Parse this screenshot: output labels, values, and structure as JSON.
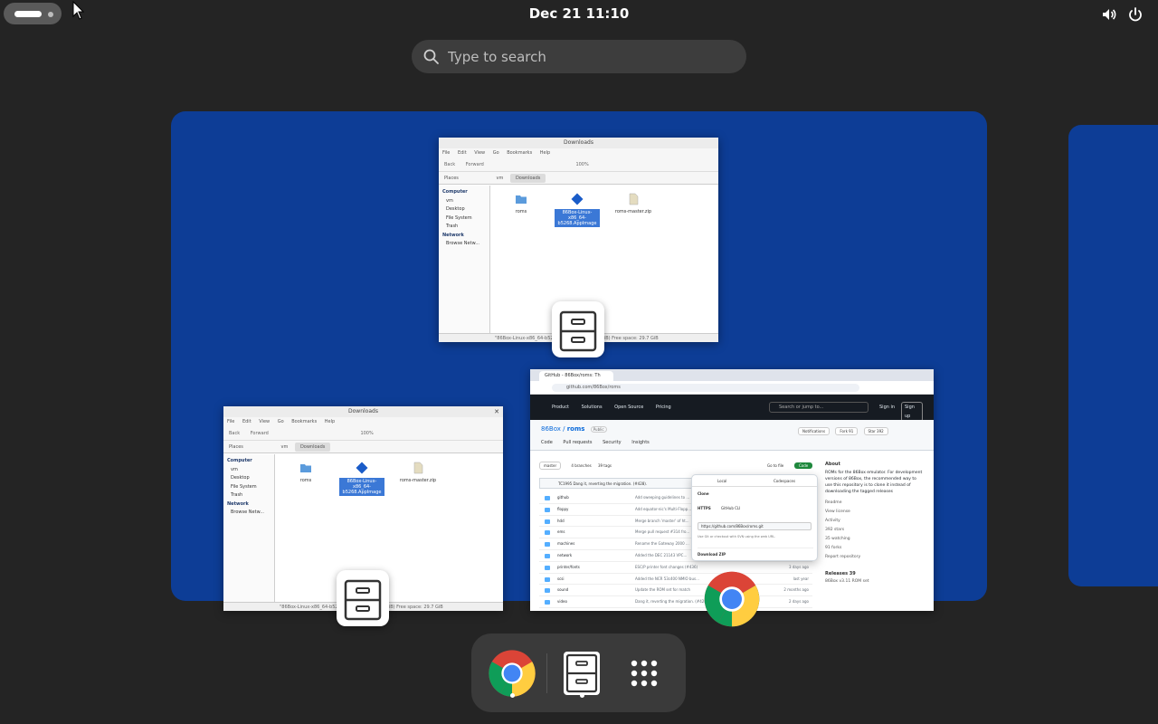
{
  "topbar": {
    "clock": "Dec 21  11:10",
    "icons": [
      "volume-icon",
      "power-icon"
    ]
  },
  "search": {
    "placeholder": "Type to search"
  },
  "fm_small": {
    "title": "Downloads",
    "menu": [
      "File",
      "Edit",
      "View",
      "Go",
      "Bookmarks",
      "Help"
    ],
    "tools": [
      "Back",
      "Forward",
      "100%"
    ],
    "path_root": "vm",
    "path_current": "Downloads",
    "places_label": "Places",
    "sidebar": {
      "computer": "Computer",
      "items": [
        "vm",
        "Desktop",
        "File System",
        "Trash"
      ],
      "network": "Network",
      "browse": "Browse Netw..."
    },
    "files": [
      {
        "name": "roms",
        "type": "folder"
      },
      {
        "name": "86Box-Linux-x86_64-b5268.AppImage",
        "type": "appimage"
      },
      {
        "name": "roms-master.zip",
        "type": "zip"
      }
    ],
    "status": "\"86Box-Linux-x86_64-b5268.AppImage\" (55.4 MiB) Free space: 29.7 GiB"
  },
  "fm_large": {
    "title": "Downloads",
    "menu": [
      "File",
      "Edit",
      "View",
      "Go",
      "Bookmarks",
      "Help"
    ],
    "tools": [
      "Back",
      "Forward",
      "100%"
    ],
    "path_root": "vm",
    "path_current": "Downloads",
    "places_label": "Places",
    "sidebar": {
      "computer": "Computer",
      "items": [
        "vm",
        "Desktop",
        "File System",
        "Trash"
      ],
      "network": "Network",
      "browse": "Browse Netw..."
    },
    "files": [
      {
        "name": "roms",
        "type": "folder"
      },
      {
        "name": "86Box-Linux-x86_64-b5268.AppImage",
        "type": "appimage"
      },
      {
        "name": "roms-master.zip",
        "type": "zip"
      }
    ],
    "status": "\"86Box-Linux-x86_64-b5268.AppImage\" (55.4 MiB) Free space: 29.7 GiB"
  },
  "chrome": {
    "tab": "GitHub - 86Box/roms: Th",
    "url": "github.com/86Box/roms",
    "gh_nav": [
      "Product",
      "Solutions",
      "Open Source",
      "Pricing"
    ],
    "gh_search": "Search or jump to...",
    "signin": "Sign in",
    "signup": "Sign up",
    "repo_owner": "86Box",
    "repo_name": "roms",
    "repo_visibility": "Public",
    "repo_tabs": [
      "Code",
      "Pull requests",
      "Security",
      "Insights"
    ],
    "repo_actions": [
      "Notifications",
      "Fork 91",
      "Star 392"
    ],
    "branch": "master",
    "branches": "4 branches",
    "tags": "39 tags",
    "go_to_file": "Go to file",
    "code_btn": "Code",
    "commit": "TC1995 Dang it, reverting the migration. (#428).",
    "rows": [
      {
        "name": "github",
        "msg": "Add sweeping guidelines to ...",
        "date": ""
      },
      {
        "name": "floppy",
        "msg": "Add equator-nic's Multi-Flopp...",
        "date": ""
      },
      {
        "name": "hdd",
        "msg": "Merge branch 'master' of ht...",
        "date": ""
      },
      {
        "name": "ems",
        "msg": "Merge pull request #314 fro...",
        "date": ""
      },
      {
        "name": "machines",
        "msg": "Rename the Gateway 2000 ...",
        "date": ""
      },
      {
        "name": "network",
        "msg": "Added the DEC 21143 VPC...",
        "date": ""
      },
      {
        "name": "printer/fonts",
        "msg": "ESC/P printer font changes (#436)",
        "date": "3 days ago"
      },
      {
        "name": "scsi",
        "msg": "Added the NCR 53c400 NMIO bus...",
        "date": "last year"
      },
      {
        "name": "sound",
        "msg": "Update the ROM set for match",
        "date": "2 months ago"
      },
      {
        "name": "video",
        "msg": "Dang it, reverting the migration. (#428)",
        "date": "2 days ago"
      }
    ],
    "about_title": "About",
    "about_text": "ROMs for the 86Box emulator. For development versions of 86Box, the recommended way to use this repository is to clone it instead of downloading the tagged releases",
    "about_links": [
      "Readme",
      "View license",
      "Activity",
      "392 stars",
      "35 watching",
      "91 forks",
      "Report repository"
    ],
    "releases": "Releases 39",
    "latest_release": "86Box v3.11 ROM set",
    "popup": {
      "tab_local": "Local",
      "tab_codespaces": "Codespaces",
      "clone": "Clone",
      "https": "HTTPS",
      "cli": "GitHub CLI",
      "clone_url": "https://github.com/86Box/roms.git",
      "hint": "Use Git or checkout with SVN using the web URL.",
      "download_zip": "Download ZIP"
    }
  },
  "dash": {
    "apps": [
      "google-chrome",
      "file-cabinet",
      "show-apps-grid"
    ]
  },
  "colors": {
    "background": "#242424",
    "workspace": "#0d3d96",
    "dash": "#3a3a3a",
    "selection": "#3b78d6"
  }
}
